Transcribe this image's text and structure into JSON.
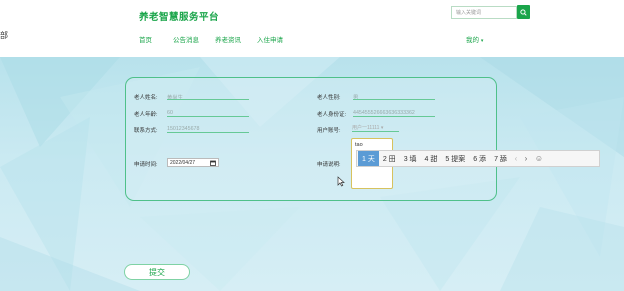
{
  "brand": "养老智慧服务平台",
  "edge_glyph": "部",
  "search": {
    "placeholder": "输入关键词"
  },
  "nav": [
    "首页",
    "公告消息",
    "养老资讯",
    "入住申请"
  ],
  "user_menu": "我的",
  "form": {
    "name_label": "老人姓名:",
    "name_value": "黄尚生",
    "gender_label": "老人性别:",
    "gender_value": "男",
    "age_label": "老人年龄:",
    "age_value": "60",
    "id_label": "老人身份证:",
    "id_value": "445455526663636333362",
    "contact_label": "联系方式:",
    "contact_value": "15012345678",
    "account_label": "用户账号:",
    "account_value": "用户一11111",
    "date_label": "申请时间:",
    "date_value": "2022/04/27",
    "note_label": "申请说明:",
    "note_value": "tao"
  },
  "ime": {
    "candidates": [
      "1 天",
      "2 田",
      "3 填",
      "4 甜",
      "5 提案",
      "6 添",
      "7 舔"
    ],
    "prev": "‹",
    "next": "›",
    "emoji": "☺"
  },
  "submit_label": "提交",
  "colors": {
    "accent": "#1aa54a",
    "panel_border": "#4fc08a",
    "ime_active": "#5b9bd5"
  }
}
